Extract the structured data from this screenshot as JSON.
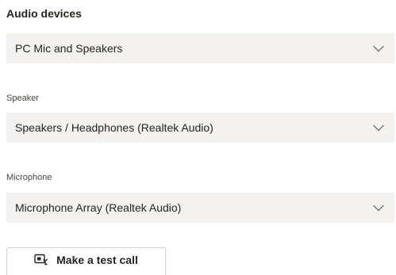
{
  "audio_devices": {
    "title": "Audio devices",
    "selected": "PC Mic and Speakers"
  },
  "speaker": {
    "label": "Speaker",
    "selected": "Speakers / Headphones (Realtek Audio)"
  },
  "microphone": {
    "label": "Microphone",
    "selected": "Microphone Array (Realtek Audio)"
  },
  "test_call": {
    "label": "Make a test call",
    "icon": "test-call-icon"
  },
  "colors": {
    "dropdown_bg": "#f3f2f1",
    "text": "#252423",
    "label_text": "#484644",
    "border": "#d1d1d1"
  }
}
